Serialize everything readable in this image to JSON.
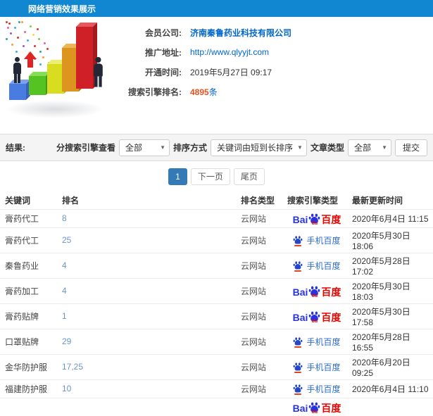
{
  "header": {
    "title": "网络营销效果展示"
  },
  "info": {
    "rows": [
      {
        "label": "会员公司:",
        "value": "济南秦鲁药业科技有限公司"
      },
      {
        "label": "推广地址:",
        "value": "http://www.qlyyjt.com"
      },
      {
        "label": "开通时间:",
        "value": "2019年5月27日 09:17"
      },
      {
        "label": "搜索引擎排名:",
        "value": "4895",
        "suffix": "条"
      }
    ]
  },
  "filters": {
    "result_label": "结果:",
    "engine_view_label": "分搜索引擎查看",
    "engine_view_value": "全部",
    "sort_label": "排序方式",
    "sort_value": "关键词由短到长排序",
    "article_type_label": "文章类型",
    "article_type_value": "全部",
    "submit_label": "提交"
  },
  "pagination": {
    "current": "1",
    "next": "下一页",
    "last": "尾页"
  },
  "table": {
    "headers": [
      "关键词",
      "排名",
      "排名类型",
      "搜索引擎类型",
      "最新更新时间"
    ],
    "engine_labels": {
      "baidu_bai": "Bai",
      "baidu_du": "du",
      "baidu_cn": "百度",
      "mobile": "手机百度"
    },
    "rows": [
      {
        "keyword": "膏药代工",
        "rank": "8",
        "rank_type": "云网站",
        "engine": "baidu",
        "updated": "2020年6月4日 11:15"
      },
      {
        "keyword": "膏药代工",
        "rank": "25",
        "rank_type": "云网站",
        "engine": "mobile",
        "updated": "2020年5月30日 18:06"
      },
      {
        "keyword": "秦鲁药业",
        "rank": "4",
        "rank_type": "云网站",
        "engine": "mobile",
        "updated": "2020年5月28日 17:02"
      },
      {
        "keyword": "膏药加工",
        "rank": "4",
        "rank_type": "云网站",
        "engine": "baidu",
        "updated": "2020年5月30日 18:03"
      },
      {
        "keyword": "膏药贴牌",
        "rank": "1",
        "rank_type": "云网站",
        "engine": "baidu",
        "updated": "2020年5月30日 17:58"
      },
      {
        "keyword": "口罩贴牌",
        "rank": "29",
        "rank_type": "云网站",
        "engine": "mobile",
        "updated": "2020年5月28日 16:55"
      },
      {
        "keyword": "金华防护服",
        "rank": "17,25",
        "rank_type": "云网站",
        "engine": "mobile",
        "updated": "2020年6月20日 09:25"
      },
      {
        "keyword": "福建防护服",
        "rank": "10",
        "rank_type": "云网站",
        "engine": "mobile",
        "updated": "2020年6月4日 11:10"
      }
    ],
    "partial_row": {
      "keyword": "",
      "rank": "",
      "rank_type": "",
      "engine": "baidu",
      "updated": ""
    }
  },
  "colors": {
    "header_bg": "#1287d1",
    "link": "#0066cc",
    "highlight": "#e8511d",
    "rank": "#6b96c6",
    "baidu_blue": "#2932e1",
    "baidu_red": "#e10602",
    "mobile_blue": "#2e6dd2",
    "pagination_active": "#337ab7"
  }
}
